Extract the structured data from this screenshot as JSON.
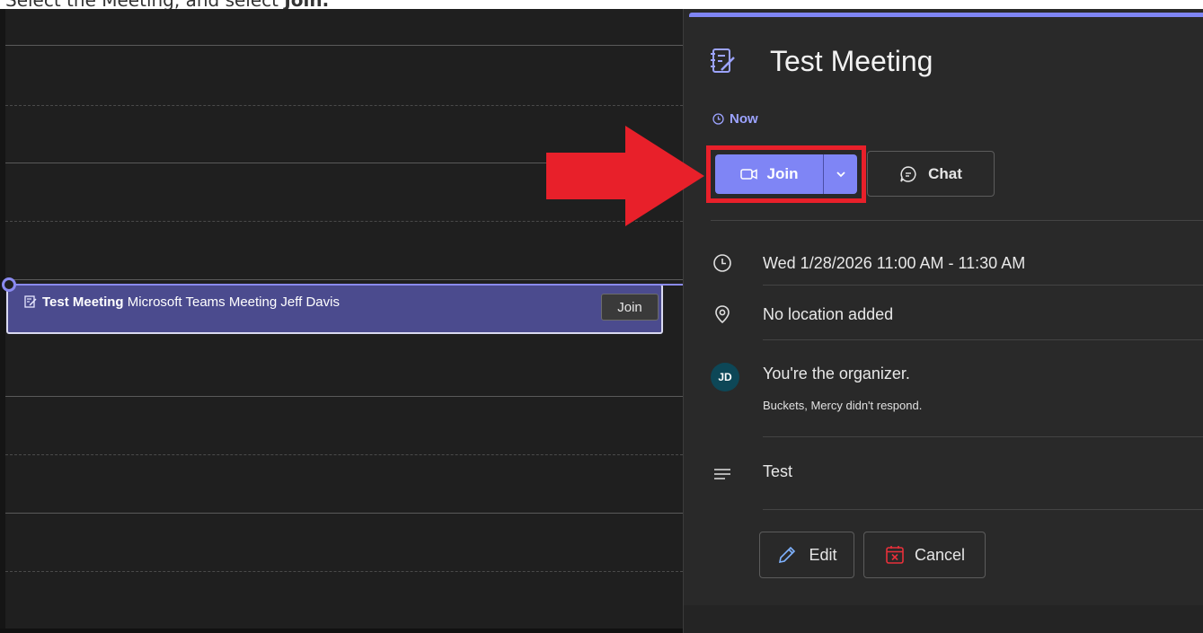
{
  "caption": {
    "prefix": "Select the Meeting, and select ",
    "bold": "Join."
  },
  "calendar": {
    "event": {
      "title": "Test Meeting",
      "details": "Microsoft Teams Meeting Jeff Davis",
      "join_label": "Join"
    }
  },
  "detail": {
    "title": "Test Meeting",
    "status": "Now",
    "join_label": "Join",
    "chat_label": "Chat",
    "datetime": "Wed 1/28/2026 11:00 AM - 11:30 AM",
    "location": "No location added",
    "organizer_initials": "JD",
    "organizer_text": "You're the organizer.",
    "response_text": "Buckets, Mercy didn't respond.",
    "description": "Test",
    "edit_label": "Edit",
    "cancel_label": "Cancel"
  },
  "colors": {
    "accent": "#7f85f5",
    "event_bg": "#4b4b8e",
    "highlight_red": "#e8202a",
    "avatar_bg": "#0d4757"
  },
  "icons": [
    "notes-icon",
    "clock-icon",
    "video-camera-icon",
    "chevron-down-icon",
    "chat-icon",
    "location-icon",
    "text-lines-icon",
    "pencil-icon",
    "calendar-cancel-icon",
    "arrow-icon"
  ]
}
